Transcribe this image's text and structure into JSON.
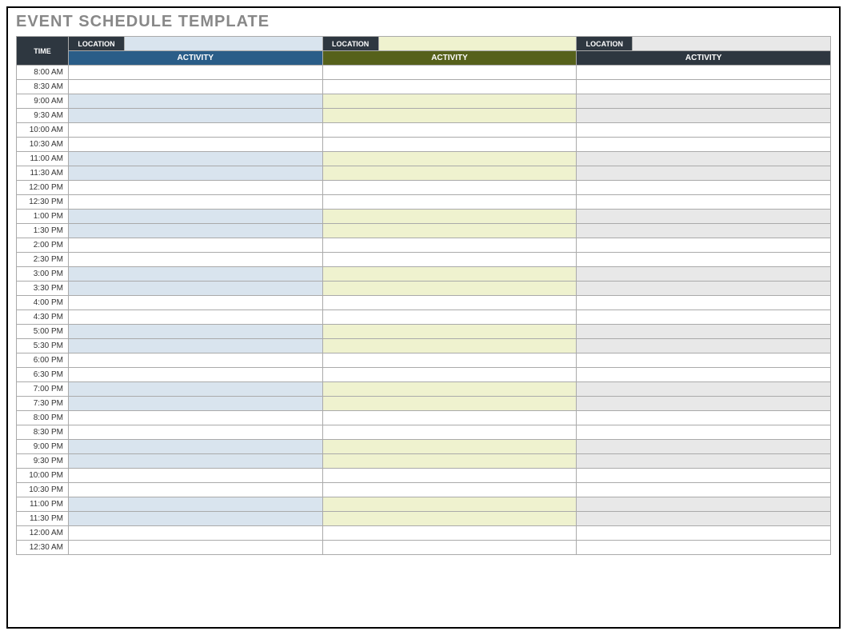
{
  "title": "EVENT SCHEDULE TEMPLATE",
  "headers": {
    "time": "TIME",
    "location": "LOCATION",
    "activity": "ACTIVITY"
  },
  "columns": [
    {
      "location_value": "",
      "tint_class": "cell-blue",
      "loc_input_class": "hdr-loc-input1",
      "activity_class": "hdr-activity1"
    },
    {
      "location_value": "",
      "tint_class": "cell-olive",
      "loc_input_class": "hdr-loc-input2",
      "activity_class": "hdr-activity2"
    },
    {
      "location_value": "",
      "tint_class": "cell-gray",
      "loc_input_class": "hdr-loc-input3",
      "activity_class": "hdr-activity3"
    }
  ],
  "time_slots": [
    "8:00 AM",
    "8:30 AM",
    "9:00 AM",
    "9:30 AM",
    "10:00 AM",
    "10:30 AM",
    "11:00 AM",
    "11:30 AM",
    "12:00 PM",
    "12:30 PM",
    "1:00 PM",
    "1:30 PM",
    "2:00 PM",
    "2:30 PM",
    "3:00 PM",
    "3:30 PM",
    "4:00 PM",
    "4:30 PM",
    "5:00 PM",
    "5:30 PM",
    "6:00 PM",
    "6:30 PM",
    "7:00 PM",
    "7:30 PM",
    "8:00 PM",
    "8:30 PM",
    "9:00 PM",
    "9:30 PM",
    "10:00 PM",
    "10:30 PM",
    "11:00 PM",
    "11:30 PM",
    "12:00 AM",
    "12:30 AM"
  ],
  "shading_pattern": [
    false,
    false,
    true,
    true,
    false,
    false,
    true,
    true,
    false,
    false,
    true,
    true,
    false,
    false,
    true,
    true,
    false,
    false,
    true,
    true,
    false,
    false,
    true,
    true,
    false,
    false,
    true,
    true,
    false,
    false,
    true,
    true,
    false,
    false
  ],
  "activities": {}
}
